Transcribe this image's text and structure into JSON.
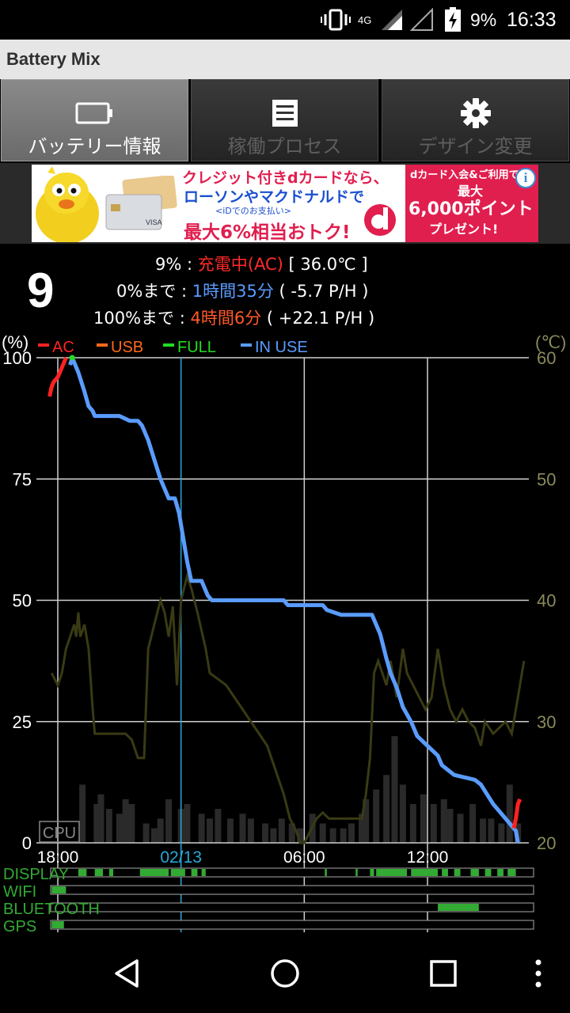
{
  "status_bar": {
    "network": "4G",
    "battery_percent": "9%",
    "time": "16:33",
    "icons": [
      "vibrate-icon",
      "signal-icon",
      "signal-icon",
      "battery-charging-icon"
    ]
  },
  "app": {
    "title": "Battery Mix"
  },
  "tabs": [
    {
      "label": "バッテリー情報",
      "icon": "battery-icon",
      "active": true
    },
    {
      "label": "稼働プロセス",
      "icon": "list-icon",
      "active": false
    },
    {
      "label": "デザイン変更",
      "icon": "gear-icon",
      "active": false
    }
  ],
  "ad": {
    "line1": "クレジット付きdカードなら、",
    "line2": "ローソンやマクドナルドで",
    "line3": "<iDでのお支払い>",
    "line4": "最大6%相当おトク!",
    "right1": "dカード入会&ご利用で",
    "right2": "最大",
    "right3": "6,000ポイント",
    "right4": "プレゼント!",
    "info": "i",
    "card_text": "VISA"
  },
  "battery": {
    "level": "9",
    "line1": {
      "pct": "9%",
      "sep": " : ",
      "status": "充電中(AC)",
      "temp": " [ 36.0℃ ]"
    },
    "line2": {
      "label": "0%まで",
      "sep": " : ",
      "time": "1時間35分",
      "rate": " ( -5.7 P/H )"
    },
    "line3": {
      "label": "100%まで",
      "sep": " : ",
      "time": "4時間6分",
      "rate": " ( +22.1 P/H )"
    }
  },
  "colors": {
    "ac": "#ff2222",
    "usb": "#ff6a1a",
    "full": "#22dd22",
    "in_use": "#5a9cff",
    "temp_line": "#3a3a14",
    "cpu_bars": "#2a2a2a",
    "usage_bar": "#33aa33"
  },
  "chart_data": {
    "type": "line",
    "y_unit_left": "(%)",
    "y_unit_right": "(℃)",
    "y_ticks_left": [
      "100",
      "75",
      "50",
      "25",
      "0"
    ],
    "y_ticks_right": [
      "60",
      "50",
      "40",
      "30",
      "20"
    ],
    "ylim_left": [
      0,
      100
    ],
    "ylim_right": [
      20,
      60
    ],
    "x_ticks": [
      "18:00",
      "02/13",
      "06:00",
      "12:00"
    ],
    "xlim_hours": [
      0,
      23
    ],
    "x_tick_hours": [
      0,
      6,
      12,
      18
    ],
    "legend": [
      {
        "name": "AC",
        "color": "#ff2222"
      },
      {
        "name": "USB",
        "color": "#ff6a1a"
      },
      {
        "name": "FULL",
        "color": "#22dd22"
      },
      {
        "name": "IN USE",
        "color": "#5a9cff"
      }
    ],
    "cpu_label": "CPU",
    "battery_series": [
      [
        0.6,
        98.5
      ],
      [
        0.7,
        100
      ],
      [
        0.8,
        99
      ],
      [
        1.0,
        97
      ],
      [
        1.3,
        93
      ],
      [
        1.5,
        90
      ],
      [
        1.7,
        89
      ],
      [
        1.8,
        88
      ],
      [
        3.0,
        88
      ],
      [
        3.5,
        87
      ],
      [
        3.9,
        87
      ],
      [
        4.1,
        86
      ],
      [
        4.4,
        83
      ],
      [
        4.7,
        79
      ],
      [
        5.0,
        75
      ],
      [
        5.4,
        71
      ],
      [
        5.7,
        71
      ],
      [
        5.9,
        68
      ],
      [
        6.1,
        63
      ],
      [
        6.3,
        58
      ],
      [
        6.5,
        54
      ],
      [
        7.0,
        54
      ],
      [
        7.3,
        51
      ],
      [
        7.5,
        50
      ],
      [
        11.0,
        50
      ],
      [
        11.2,
        49
      ],
      [
        12.9,
        49
      ],
      [
        13.1,
        48
      ],
      [
        13.8,
        47
      ],
      [
        15.3,
        47
      ],
      [
        15.7,
        43
      ],
      [
        16.0,
        38
      ],
      [
        16.2,
        35
      ],
      [
        16.5,
        32
      ],
      [
        16.8,
        28
      ],
      [
        17.2,
        25
      ],
      [
        17.5,
        22
      ],
      [
        18.0,
        20
      ],
      [
        18.5,
        18
      ],
      [
        18.7,
        16
      ],
      [
        19.0,
        15
      ],
      [
        19.3,
        14
      ],
      [
        20.3,
        13
      ],
      [
        20.6,
        12
      ],
      [
        20.9,
        10
      ],
      [
        21.2,
        8
      ],
      [
        21.6,
        6
      ],
      [
        22.0,
        4
      ],
      [
        22.3,
        2.5
      ],
      [
        22.4,
        0
      ]
    ],
    "ac_series": [
      [
        -0.4,
        92
      ],
      [
        -0.3,
        94
      ],
      [
        -0.2,
        95
      ],
      [
        0.0,
        96
      ],
      [
        0.2,
        98
      ],
      [
        0.4,
        100
      ],
      [
        22.2,
        3
      ],
      [
        22.3,
        5
      ],
      [
        22.4,
        8
      ],
      [
        22.5,
        9
      ]
    ],
    "temp_series": [
      [
        -0.3,
        34
      ],
      [
        0.0,
        33
      ],
      [
        0.2,
        34
      ],
      [
        0.4,
        36
      ],
      [
        0.6,
        37
      ],
      [
        0.8,
        38
      ],
      [
        0.9,
        37
      ],
      [
        1.0,
        39
      ],
      [
        1.1,
        37
      ],
      [
        1.3,
        38
      ],
      [
        1.5,
        36
      ],
      [
        1.7,
        31
      ],
      [
        1.8,
        29
      ],
      [
        2.0,
        29
      ],
      [
        2.5,
        29
      ],
      [
        3.0,
        29
      ],
      [
        3.3,
        29
      ],
      [
        3.6,
        28.5
      ],
      [
        3.9,
        27
      ],
      [
        4.2,
        27
      ],
      [
        4.4,
        36
      ],
      [
        4.7,
        38
      ],
      [
        5.0,
        40
      ],
      [
        5.2,
        39
      ],
      [
        5.4,
        37
      ],
      [
        5.6,
        39.5
      ],
      [
        5.8,
        33
      ],
      [
        6.0,
        40
      ],
      [
        6.3,
        42
      ],
      [
        6.5,
        41
      ],
      [
        6.8,
        39
      ],
      [
        7.2,
        36
      ],
      [
        7.4,
        34
      ],
      [
        7.8,
        33.5
      ],
      [
        8.2,
        33
      ],
      [
        8.6,
        32
      ],
      [
        9.0,
        31
      ],
      [
        9.4,
        30
      ],
      [
        9.8,
        29
      ],
      [
        10.2,
        28
      ],
      [
        10.6,
        26
      ],
      [
        11.0,
        24
      ],
      [
        11.3,
        22
      ],
      [
        11.6,
        21
      ],
      [
        11.8,
        20
      ],
      [
        12.0,
        20
      ],
      [
        12.3,
        21
      ],
      [
        12.6,
        22
      ],
      [
        12.9,
        22.5
      ],
      [
        13.2,
        22
      ],
      [
        13.5,
        22
      ],
      [
        14.0,
        22
      ],
      [
        14.5,
        22
      ],
      [
        14.8,
        22
      ],
      [
        15.0,
        24
      ],
      [
        15.2,
        27
      ],
      [
        15.4,
        34
      ],
      [
        15.6,
        35
      ],
      [
        15.8,
        34
      ],
      [
        16.0,
        33
      ],
      [
        16.2,
        35
      ],
      [
        16.5,
        32
      ],
      [
        16.8,
        36
      ],
      [
        17.0,
        34
      ],
      [
        17.3,
        33
      ],
      [
        17.6,
        32
      ],
      [
        17.9,
        31
      ],
      [
        18.2,
        32
      ],
      [
        18.5,
        36
      ],
      [
        18.8,
        33
      ],
      [
        19.1,
        31
      ],
      [
        19.4,
        30
      ],
      [
        19.7,
        31
      ],
      [
        20.0,
        30
      ],
      [
        20.3,
        29.5
      ],
      [
        20.6,
        28
      ],
      [
        20.8,
        30
      ],
      [
        21.2,
        29
      ],
      [
        21.5,
        29.5
      ],
      [
        21.8,
        30
      ],
      [
        22.1,
        29
      ],
      [
        22.4,
        32
      ],
      [
        22.6,
        34
      ],
      [
        22.7,
        35
      ]
    ],
    "cpu_bars": [
      [
        1.2,
        12
      ],
      [
        1.9,
        8
      ],
      [
        2.1,
        10
      ],
      [
        2.5,
        7
      ],
      [
        3.0,
        6
      ],
      [
        3.3,
        9
      ],
      [
        3.6,
        8
      ],
      [
        4.3,
        4
      ],
      [
        4.7,
        3
      ],
      [
        5.0,
        5
      ],
      [
        5.4,
        9
      ],
      [
        6.0,
        7
      ],
      [
        6.3,
        8
      ],
      [
        7.0,
        6
      ],
      [
        7.4,
        5
      ],
      [
        7.8,
        7
      ],
      [
        8.4,
        5
      ],
      [
        9.0,
        6
      ],
      [
        9.4,
        5
      ],
      [
        10.1,
        4
      ],
      [
        10.5,
        3
      ],
      [
        10.9,
        5
      ],
      [
        11.4,
        4
      ],
      [
        11.8,
        3
      ],
      [
        12.4,
        6
      ],
      [
        12.9,
        4
      ],
      [
        13.4,
        3
      ],
      [
        13.9,
        3
      ],
      [
        14.3,
        4
      ],
      [
        14.8,
        6
      ],
      [
        15.0,
        9
      ],
      [
        15.5,
        11
      ],
      [
        16.0,
        14
      ],
      [
        16.4,
        22
      ],
      [
        16.8,
        12
      ],
      [
        17.3,
        8
      ],
      [
        17.8,
        10
      ],
      [
        18.3,
        8
      ],
      [
        18.8,
        9
      ],
      [
        19.1,
        7
      ],
      [
        19.6,
        6
      ],
      [
        20.2,
        8
      ],
      [
        20.7,
        5
      ],
      [
        21.1,
        5
      ],
      [
        21.6,
        4
      ],
      [
        22.0,
        12
      ],
      [
        22.4,
        4
      ]
    ],
    "usage_rows": [
      {
        "label": "DISPLAY",
        "segments": [
          [
            1.0,
            1.4
          ],
          [
            1.8,
            2.2
          ],
          [
            2.5,
            2.7
          ],
          [
            4.0,
            5.4
          ],
          [
            5.5,
            6.2
          ],
          [
            6.5,
            6.8
          ],
          [
            7.0,
            7.2
          ],
          [
            13.0,
            13.1
          ],
          [
            14.5,
            14.6
          ],
          [
            15.2,
            15.4
          ],
          [
            15.5,
            17.0
          ],
          [
            17.2,
            18.5
          ],
          [
            18.7,
            19.0
          ],
          [
            19.3,
            19.6
          ],
          [
            20.1,
            20.5
          ],
          [
            20.8,
            21.1
          ],
          [
            21.4,
            21.7
          ],
          [
            21.9,
            22.3
          ]
        ]
      },
      {
        "label": "WIFI",
        "segments": [
          [
            -0.3,
            0.4
          ]
        ]
      },
      {
        "label": "BLUETOOTH",
        "segments": [
          [
            18.5,
            20.5
          ]
        ]
      },
      {
        "label": "GPS",
        "segments": [
          [
            -0.3,
            0.3
          ]
        ]
      }
    ]
  },
  "nav": {
    "buttons": [
      "back-icon",
      "home-icon",
      "recents-icon",
      "menu-icon"
    ]
  }
}
